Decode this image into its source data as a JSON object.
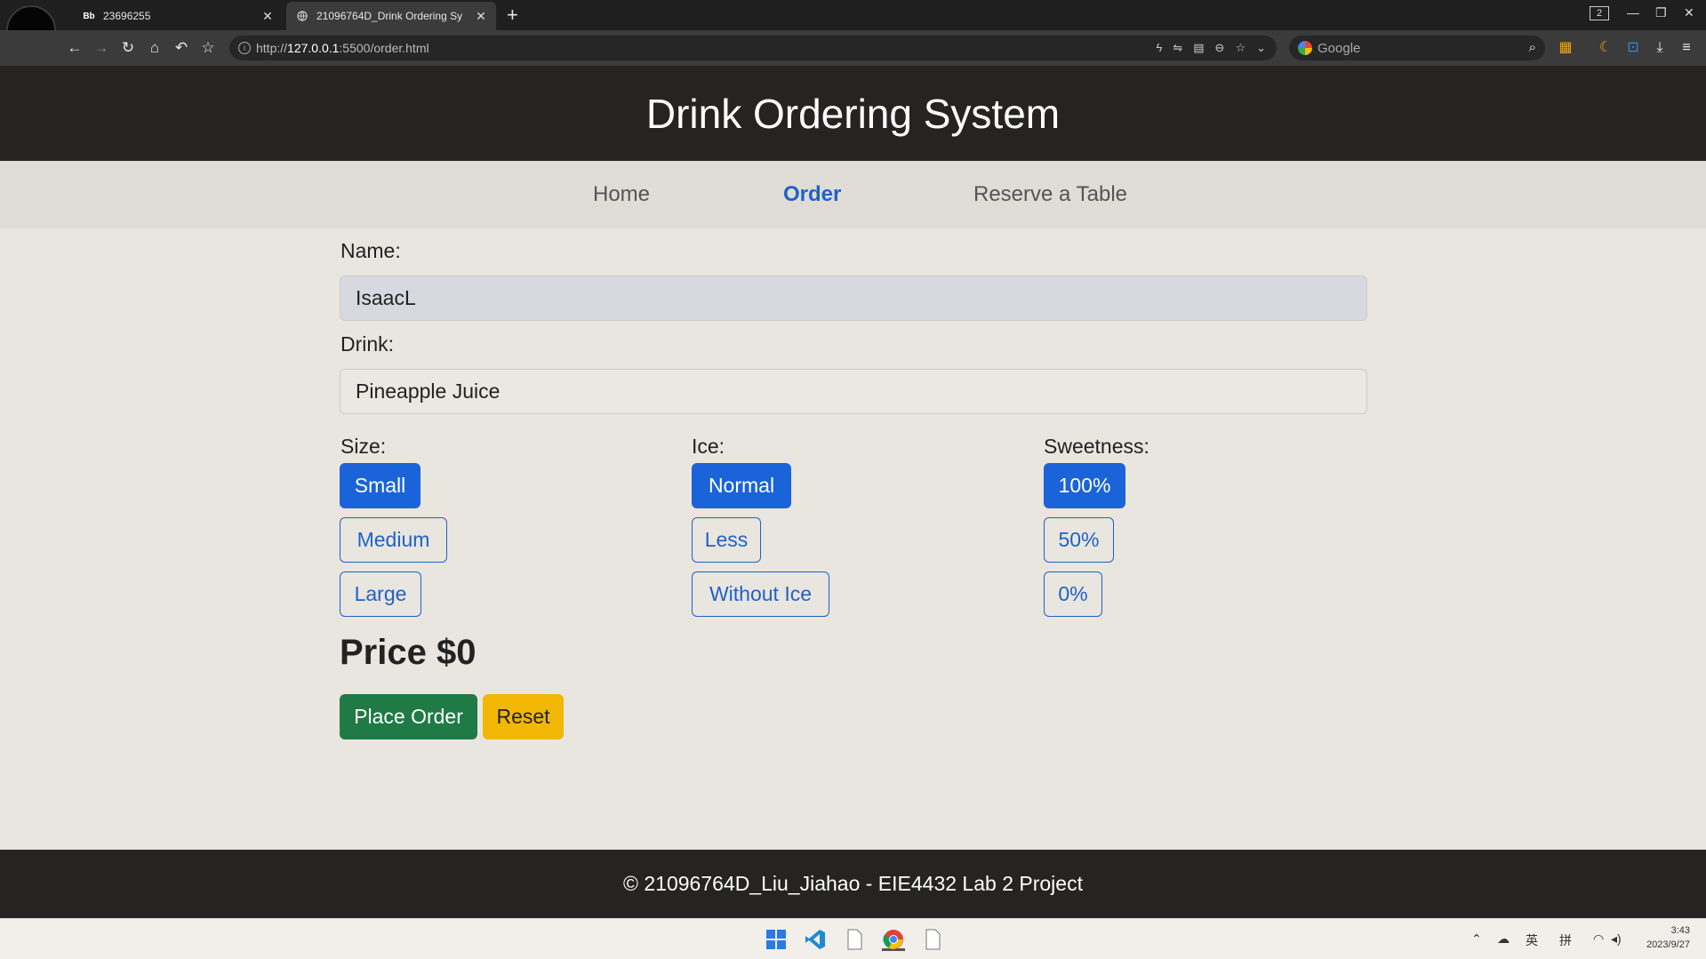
{
  "browser": {
    "tabs": [
      {
        "favicon": "Bb",
        "title": "23696255",
        "active": false
      },
      {
        "favicon": "globe-icon",
        "title": "21096764D_Drink Ordering Sy",
        "active": true
      }
    ],
    "new_tab": "+",
    "window_count": "2",
    "url_prefix": "http://",
    "url_host": "127.0.0.1",
    "url_rest": ":5500/order.html",
    "search_placeholder": "Google"
  },
  "page": {
    "title": "Drink Ordering System",
    "nav": [
      {
        "label": "Home",
        "active": false
      },
      {
        "label": "Order",
        "active": true
      },
      {
        "label": "Reserve a Table",
        "active": false
      }
    ],
    "form": {
      "name_label": "Name:",
      "name_value": "IsaacL",
      "drink_label": "Drink:",
      "drink_value": "Pineapple Juice",
      "size_label": "Size:",
      "size_options": [
        "Small",
        "Medium",
        "Large"
      ],
      "size_selected": "Small",
      "ice_label": "Ice:",
      "ice_options": [
        "Normal",
        "Less",
        "Without Ice"
      ],
      "ice_selected": "Normal",
      "sweetness_label": "Sweetness:",
      "sweetness_options": [
        "100%",
        "50%",
        "0%"
      ],
      "sweetness_selected": "100%",
      "price": "Price $0",
      "place_order": "Place Order",
      "reset": "Reset"
    },
    "footer": "© 21096764D_Liu_Jiahao - EIE4432 Lab 2 Project"
  },
  "taskbar": {
    "tray_ime_1": "英",
    "tray_ime_2": "拼",
    "time": "3:43",
    "date": "2023/9/27"
  },
  "colors": {
    "primary": "#1a63d8",
    "success": "#1f7a45",
    "warning": "#f2b705",
    "header_bg": "#252423",
    "page_bg": "#e9e5df"
  }
}
